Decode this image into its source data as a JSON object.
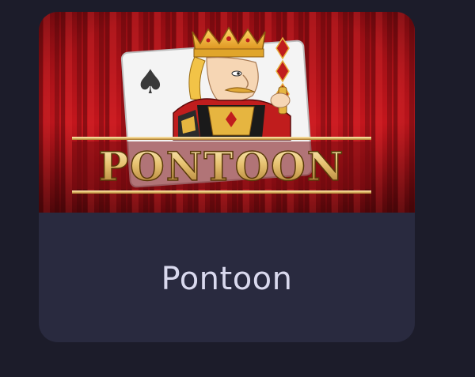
{
  "game_card": {
    "logo_text": "PONTOON",
    "name": "Pontoon",
    "card_suit_glyph": "♠",
    "colors": {
      "page_background": "#1c1c2a",
      "card_footer": "#292a3f",
      "curtain_red": "#b3141a",
      "logo_gold": "#e9c77a",
      "label_text": "#d9d9ee"
    }
  }
}
